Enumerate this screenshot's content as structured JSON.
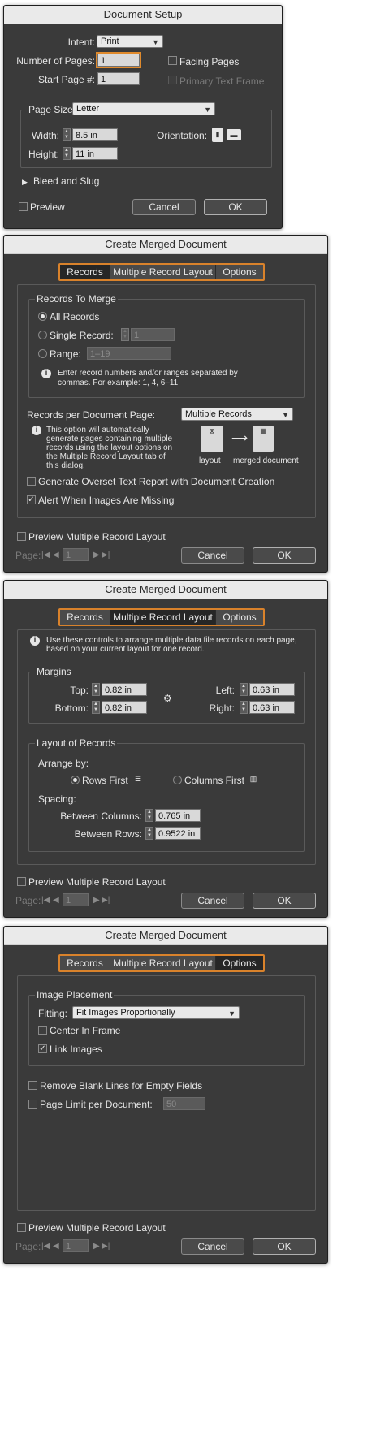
{
  "doc_setup": {
    "title": "Document Setup",
    "intent_label": "Intent:",
    "intent_value": "Print",
    "pages_label": "Number of Pages:",
    "pages_value": "1",
    "start_label": "Start Page #:",
    "start_value": "1",
    "facing_label": "Facing Pages",
    "primary_label": "Primary Text Frame",
    "page_size_label": "Page Size:",
    "page_size_value": "Letter",
    "width_label": "Width:",
    "width_value": "8.5 in",
    "height_label": "Height:",
    "height_value": "11 in",
    "orientation_label": "Orientation:",
    "bleed_label": "Bleed and Slug",
    "preview_label": "Preview",
    "cancel_label": "Cancel",
    "ok_label": "OK"
  },
  "merge_common": {
    "title": "Create Merged Document",
    "tab_records": "Records",
    "tab_layout": "Multiple Record Layout",
    "tab_options": "Options",
    "preview_label": "Preview Multiple Record Layout",
    "page_label": "Page:",
    "page_value": "1",
    "cancel_label": "Cancel",
    "ok_label": "OK"
  },
  "records": {
    "group_title": "Records To Merge",
    "all_label": "All Records",
    "single_label": "Single Record:",
    "single_value": "1",
    "range_label": "Range:",
    "range_value": "1–19",
    "range_info_1": "Enter record numbers and/or ranges separated by",
    "range_info_2": "commas. For example: 1, 4, 6–11",
    "per_page_label": "Records per Document Page:",
    "per_page_value": "Multiple Records",
    "option_info_1": "This option will automatically",
    "option_info_2": "generate pages containing multiple",
    "option_info_3": "records using the layout options on",
    "option_info_4": "the Multiple Record Layout tab of",
    "option_info_5": "this dialog.",
    "layout_caption": "layout",
    "merged_caption": "merged document",
    "overset_label": "Generate Overset Text Report with Document Creation",
    "alert_label": "Alert When Images Are Missing"
  },
  "layout": {
    "info_1": "Use these controls to arrange multiple data file records on each page,",
    "info_2": "based on your current layout for one record.",
    "margins_title": "Margins",
    "top_label": "Top:",
    "top_value": "0.82 in",
    "bottom_label": "Bottom:",
    "bottom_value": "0.82 in",
    "left_label": "Left:",
    "left_value": "0.63 in",
    "right_label": "Right:",
    "right_value": "0.63 in",
    "records_title": "Layout of Records",
    "arrange_label": "Arrange by:",
    "rows_first": "Rows First",
    "cols_first": "Columns First",
    "spacing_label": "Spacing:",
    "between_cols_label": "Between Columns:",
    "between_cols_value": "0.765 in",
    "between_rows_label": "Between Rows:",
    "between_rows_value": "0.9522 in"
  },
  "options": {
    "image_title": "Image Placement",
    "fitting_label": "Fitting:",
    "fitting_value": "Fit Images Proportionally",
    "center_label": "Center In Frame",
    "link_label": "Link Images",
    "remove_blank_label": "Remove Blank Lines for Empty Fields",
    "page_limit_label": "Page Limit per Document:",
    "page_limit_value": "50"
  }
}
